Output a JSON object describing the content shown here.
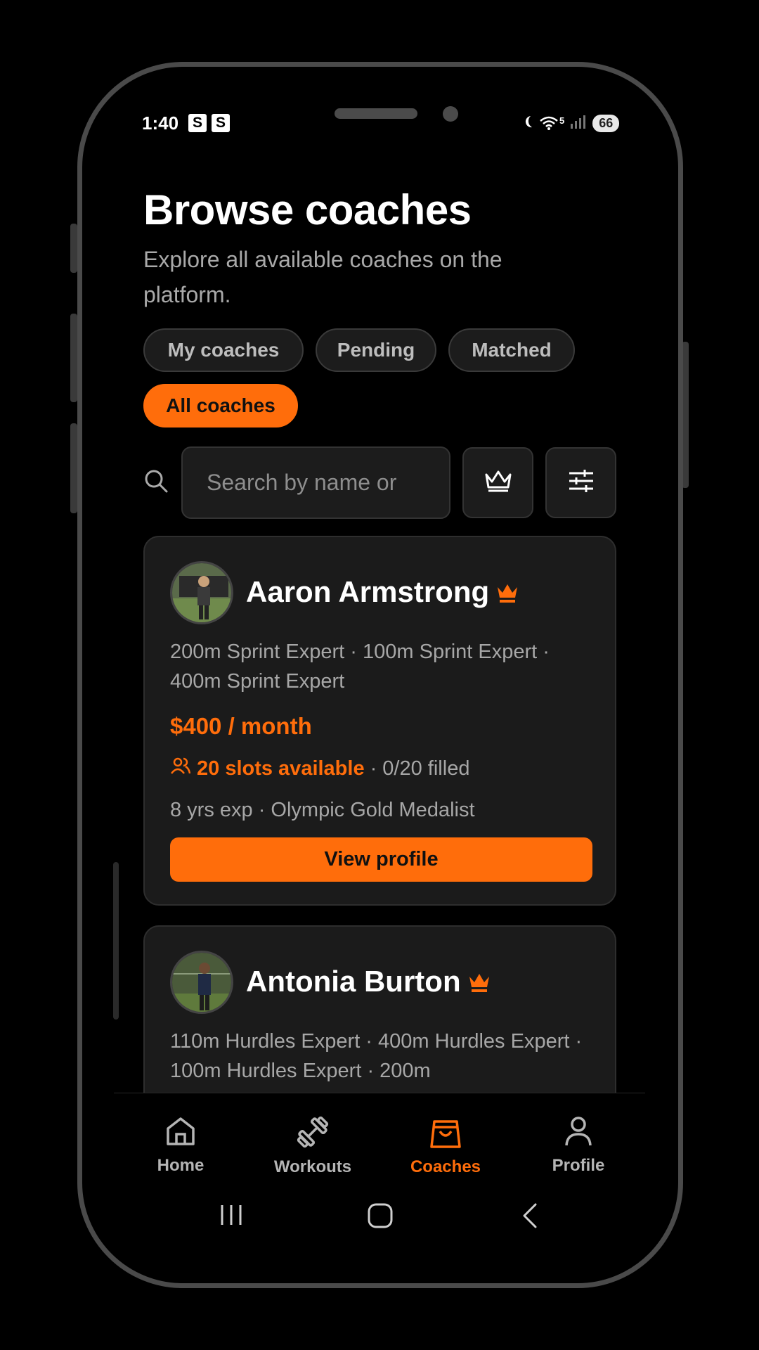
{
  "status_bar": {
    "time": "1:40",
    "badge_1": "S",
    "badge_2": "S",
    "wifi_label": "5",
    "battery": "66"
  },
  "header": {
    "title": "Browse coaches",
    "subtitle": "Explore all available coaches on the platform."
  },
  "filters": {
    "chips": [
      "My coaches",
      "Pending",
      "Matched",
      "All coaches"
    ],
    "active": "All coaches"
  },
  "search": {
    "placeholder": "Search by name or",
    "value": ""
  },
  "icons": {
    "search": "search-icon",
    "premium": "crown-icon",
    "filters": "sliders-icon"
  },
  "coaches": [
    {
      "name": "Aaron Armstrong",
      "premium": true,
      "skills": "200m Sprint Expert · 100m Sprint Expert · 400m Sprint Expert",
      "price": "$400 / month",
      "slots": "20 slots available",
      "filled": "· 0/20 filled",
      "experience": "8 yrs exp · Olympic Gold Medalist",
      "button": "View profile"
    },
    {
      "name": "Antonia Burton",
      "premium": true,
      "skills": "110m Hurdles Expert · 400m Hurdles Expert · 100m Hurdles Expert · 200m"
    }
  ],
  "nav": {
    "items": [
      {
        "label": "Home",
        "icon": "home-icon"
      },
      {
        "label": "Workouts",
        "icon": "dumbbell-icon"
      },
      {
        "label": "Coaches",
        "icon": "shopping-bag-icon"
      },
      {
        "label": "Profile",
        "icon": "user-icon"
      }
    ],
    "active": "Coaches"
  },
  "colors": {
    "accent": "#ff6d0b",
    "background": "#000000",
    "card": "#1b1b1b",
    "text_muted": "#a7a7a7"
  }
}
